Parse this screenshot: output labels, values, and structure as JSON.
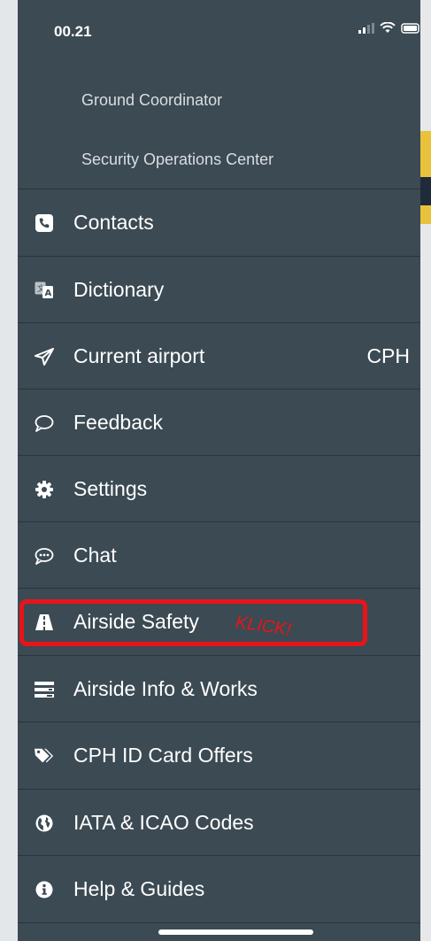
{
  "status_bar": {
    "time": "00.21"
  },
  "sub_items": [
    {
      "label": "Ground Coordinator"
    },
    {
      "label": "Security Operations Center"
    }
  ],
  "menu": [
    {
      "label": "Contacts",
      "icon": "phone-icon"
    },
    {
      "label": "Dictionary",
      "icon": "translate-icon"
    },
    {
      "label": "Current airport",
      "icon": "paper-plane-icon",
      "value": "CPH"
    },
    {
      "label": "Feedback",
      "icon": "speech-bubble-icon"
    },
    {
      "label": "Settings",
      "icon": "gear-icon"
    },
    {
      "label": "Chat",
      "icon": "chat-dots-icon"
    },
    {
      "label": "Airside Safety",
      "icon": "road-icon"
    },
    {
      "label": "Airside Info & Works",
      "icon": "list-icon"
    },
    {
      "label": "CPH ID Card Offers",
      "icon": "tags-icon"
    },
    {
      "label": "IATA & ICAO Codes",
      "icon": "globe-icon"
    },
    {
      "label": "Help & Guides",
      "icon": "info-icon"
    }
  ],
  "annotation": {
    "text": "KLICK!",
    "color": "#e8141a"
  },
  "colors": {
    "menu_bg": "#3b4a53",
    "divider": "#2a353c",
    "highlight": "#e8141a",
    "accent_strip": "#e8c23a"
  }
}
